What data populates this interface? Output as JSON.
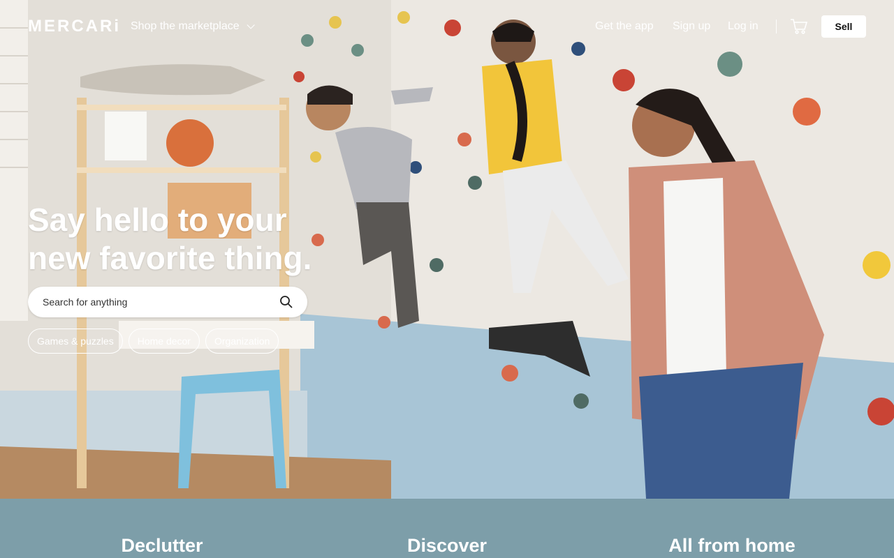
{
  "brand": {
    "logo_text": "MERCARi"
  },
  "nav": {
    "shop_label": "Shop the marketplace",
    "links": [
      "Get the app",
      "Sign up",
      "Log in"
    ],
    "sell_label": "Sell",
    "cart_icon": "cart-icon"
  },
  "hero": {
    "headline_line1": "Say hello to your",
    "headline_line2": "new favorite thing.",
    "search_placeholder": "Search for anything",
    "chips": [
      "Games & puzzles",
      "Home decor",
      "Organization"
    ]
  },
  "band": {
    "titles": [
      "Declutter",
      "Discover",
      "All from home"
    ]
  },
  "colors": {
    "band_bg": "#7d9ea9",
    "text_on_image": "#ffffff",
    "sell_bg": "#ffffff"
  }
}
